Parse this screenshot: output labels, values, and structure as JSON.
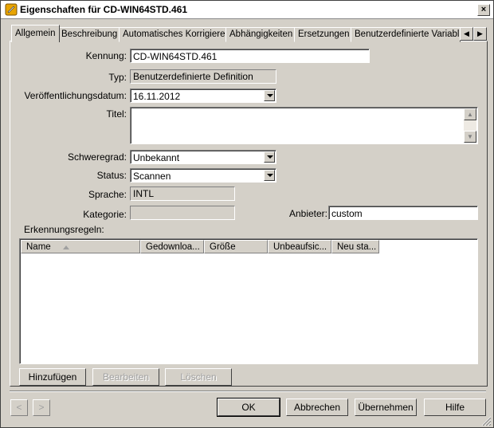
{
  "window": {
    "title": "Eigenschaften für CD-WIN64STD.461",
    "close_glyph": "×"
  },
  "tabs": [
    {
      "label": "Allgemein",
      "active": true
    },
    {
      "label": "Beschreibung"
    },
    {
      "label": "Automatisches Korrigieren"
    },
    {
      "label": "Abhängigkeiten"
    },
    {
      "label": "Ersetzungen"
    },
    {
      "label": "Benutzerdefinierte Variablen"
    }
  ],
  "form": {
    "kennung_label": "Kennung:",
    "kennung_value": "CD-WIN64STD.461",
    "typ_label": "Typ:",
    "typ_value": "Benutzerdefinierte Definition",
    "datum_label": "Veröffentlichungsdatum:",
    "datum_value": "16.11.2012",
    "titel_label": "Titel:",
    "schweregrad_label": "Schweregrad:",
    "schweregrad_value": "Unbekannt",
    "status_label": "Status:",
    "status_value": "Scannen",
    "sprache_label": "Sprache:",
    "sprache_value": "INTL",
    "kategorie_label": "Kategorie:",
    "kategorie_value": "",
    "anbieter_label": "Anbieter:",
    "anbieter_value": "custom",
    "rules_label": "Erkennungsregeln:"
  },
  "rules_table": {
    "columns": [
      "Name",
      "Gedownloa...",
      "Größe",
      "Unbeaufsic...",
      "Neu sta..."
    ],
    "rows": []
  },
  "rule_buttons": {
    "add": "Hinzufügen",
    "edit": "Bearbeiten",
    "delete": "Löschen"
  },
  "footer": {
    "back": "<",
    "forward": ">",
    "ok": "OK",
    "cancel": "Abbrechen",
    "apply": "Übernehmen",
    "help": "Hilfe"
  }
}
